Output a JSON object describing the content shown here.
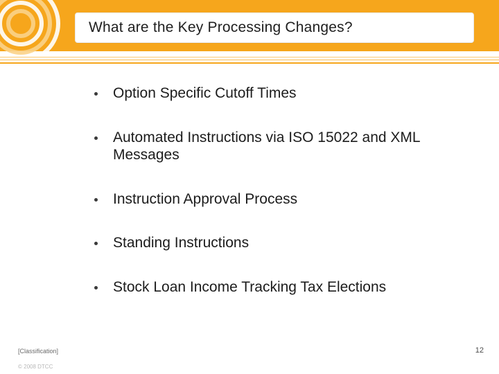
{
  "header": {
    "title": "What are the Key Processing Changes?"
  },
  "bullets": [
    {
      "text": "Option Specific Cutoff Times"
    },
    {
      "text": "Automated Instructions via ISO 15022 and XML Messages"
    },
    {
      "text": "Instruction Approval Process"
    },
    {
      "text": "Standing Instructions"
    },
    {
      "text": "Stock Loan Income Tracking Tax Elections"
    }
  ],
  "footer": {
    "classification": "[Classification]",
    "page_number": "12",
    "copyright": "© 2008 DTCC"
  }
}
